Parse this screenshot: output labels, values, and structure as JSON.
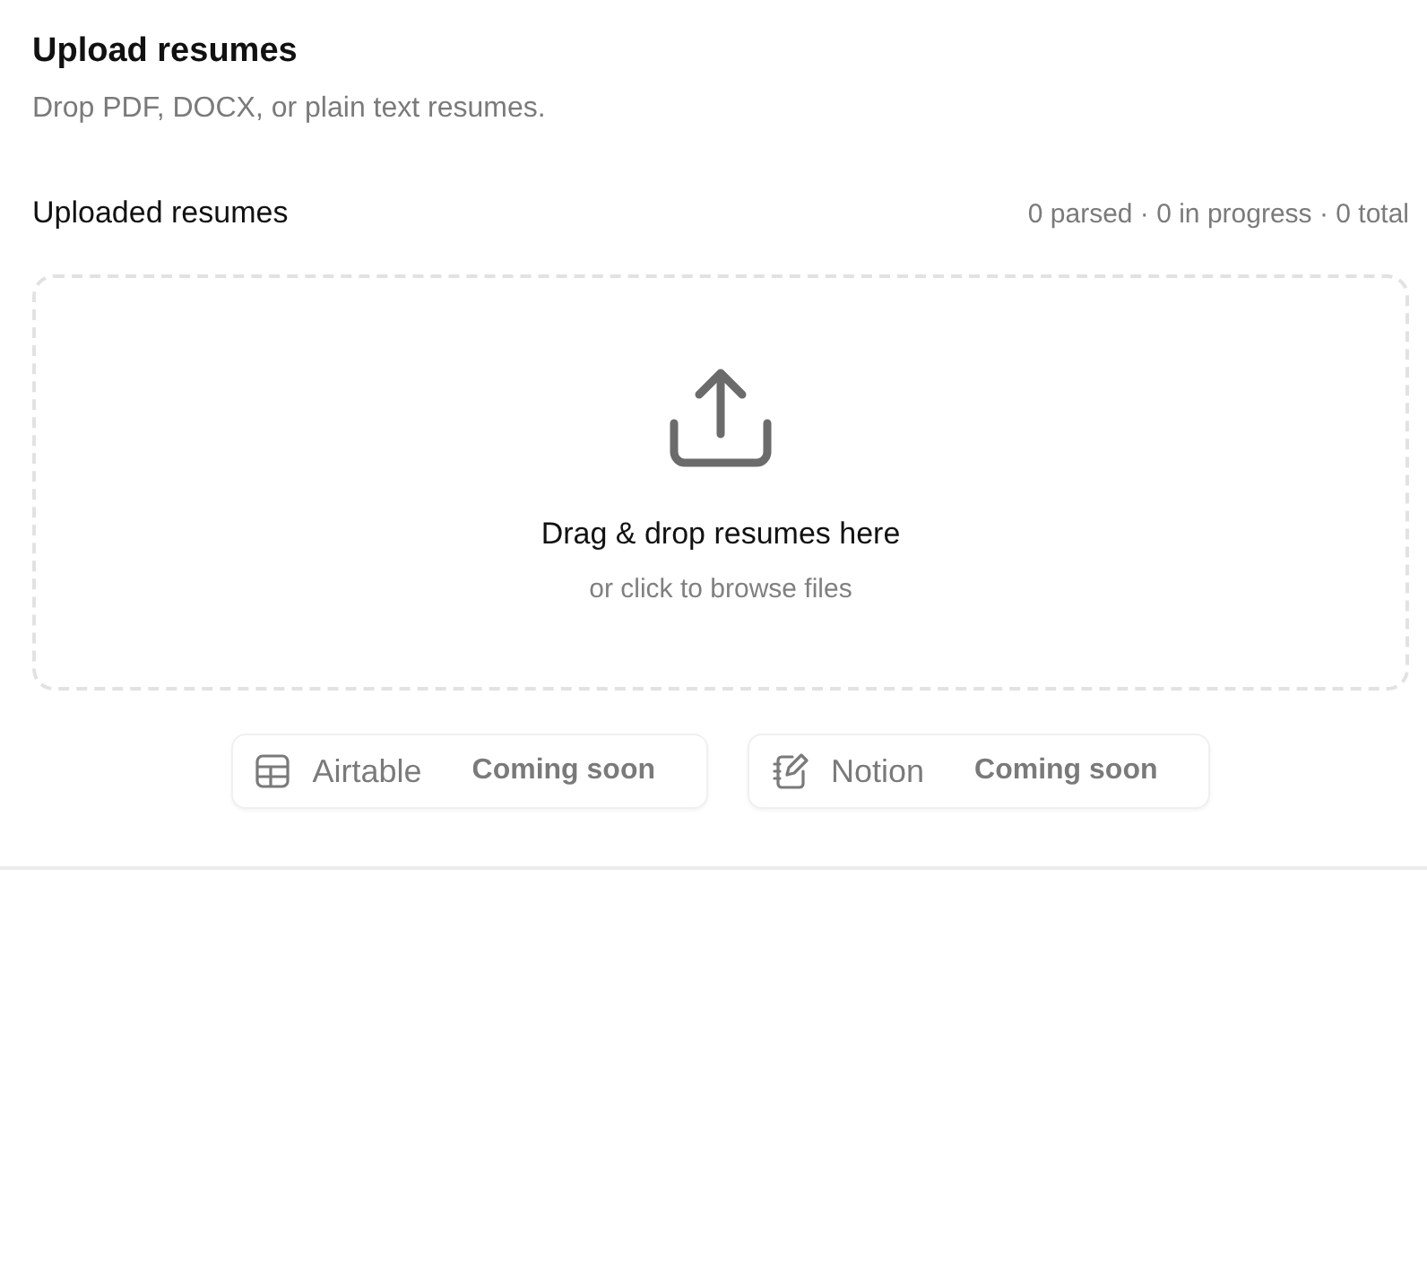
{
  "header": {
    "title": "Upload resumes",
    "subtitle": "Drop PDF, DOCX, or plain text resumes."
  },
  "section": {
    "title": "Uploaded resumes",
    "summary": "0 parsed · 0 in progress · 0 total"
  },
  "dropzone": {
    "title": "Drag & drop resumes here",
    "hint": "or click to browse files"
  },
  "integrations": [
    {
      "kind": "table",
      "label": "Airtable",
      "badge": "Coming soon",
      "disabled": true
    },
    {
      "kind": "notebook",
      "label": "Notion",
      "badge": "Coming soon",
      "disabled": true
    }
  ]
}
